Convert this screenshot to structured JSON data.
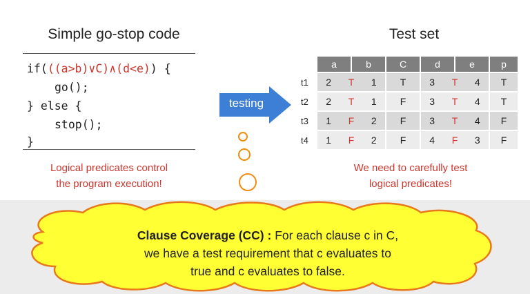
{
  "left": {
    "title": "Simple go-stop code",
    "code": {
      "if_prefix": "if(",
      "predicate": "((a>b)∨C)∧(d<e)",
      "if_suffix": ") {",
      "go": "go();",
      "else": "} else {",
      "stop": "stop();",
      "close": "}"
    },
    "note_line1": "Logical predicates control",
    "note_line2": "the program execution!"
  },
  "arrow": {
    "label": "testing",
    "color": "#3d7fd6"
  },
  "right": {
    "title": "Test set",
    "headers": [
      "a",
      "b",
      "C",
      "d",
      "e",
      "p"
    ],
    "rows": [
      {
        "label": "t1",
        "a": "2",
        "op1": "T",
        "b": "1",
        "c": "T",
        "d": "3",
        "op2": "T",
        "e": "4",
        "p": "T"
      },
      {
        "label": "t2",
        "a": "2",
        "op1": "T",
        "b": "1",
        "c": "F",
        "d": "3",
        "op2": "T",
        "e": "4",
        "p": "T"
      },
      {
        "label": "t3",
        "a": "1",
        "op1": "F",
        "b": "2",
        "c": "F",
        "d": "3",
        "op2": "T",
        "e": "4",
        "p": "F"
      },
      {
        "label": "t4",
        "a": "1",
        "op1": "F",
        "b": "2",
        "c": "F",
        "d": "4",
        "op2": "F",
        "e": "3",
        "p": "F"
      }
    ],
    "note_line1": "We need to carefully test",
    "note_line2": "logical predicates!"
  },
  "cloud": {
    "bold": "Clause Coverage (CC) :",
    "line1_rest": " For each clause c in C,",
    "line2": "we have a test requirement that c evaluates to",
    "line3": "true and c evaluates to false.",
    "fill": "#ffff33",
    "stroke": "#e8791a"
  }
}
